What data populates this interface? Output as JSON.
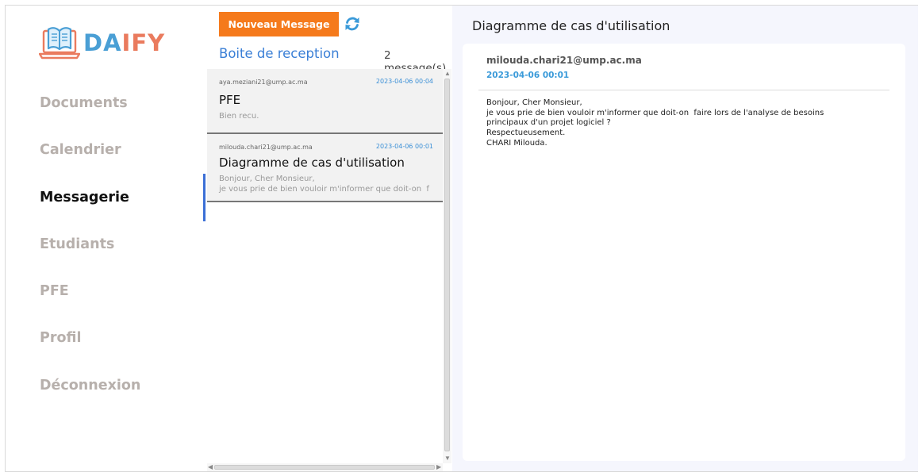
{
  "app": {
    "logo_text_part1": "DA",
    "logo_text_part2": "IFY",
    "brand_colors": {
      "blue": "#4a9fd5",
      "orange": "#ea7b5e",
      "accent_button": "#f57a1c",
      "active_indicator": "#3b6fd6"
    }
  },
  "sidebar": {
    "items": [
      {
        "label": "Documents",
        "active": false
      },
      {
        "label": "Calendrier",
        "active": false
      },
      {
        "label": "Messagerie",
        "active": true
      },
      {
        "label": "Etudiants",
        "active": false
      },
      {
        "label": "PFE",
        "active": false
      },
      {
        "label": "Profil",
        "active": false
      },
      {
        "label": "Déconnexion",
        "active": false
      }
    ]
  },
  "inbox": {
    "new_message_label": "Nouveau Message",
    "refresh_icon": "refresh-icon",
    "title": "Boite de reception",
    "count": "2 message(s)",
    "messages": [
      {
        "from": "aya.meziani21@ump.ac.ma",
        "date": "2023-04-06 00:04",
        "subject": "PFE",
        "preview": "Bien recu."
      },
      {
        "from": "milouda.chari21@ump.ac.ma",
        "date": "2023-04-06 00:01",
        "subject": "Diagramme de cas d'utilisation",
        "preview": "Bonjour, Cher Monsieur,\nje vous prie de bien vouloir m'informer que doit-on  f"
      }
    ]
  },
  "detail": {
    "title": "Diagramme de cas d'utilisation",
    "from": "milouda.chari21@ump.ac.ma",
    "date": "2023-04-06 00:01",
    "body": "Bonjour, Cher Monsieur,\nje vous prie de bien vouloir m'informer que doit-on  faire lors de l'analyse de besoins\nprincipaux d'un projet logiciel ?\nRespectueusement.\nCHARI Milouda."
  }
}
